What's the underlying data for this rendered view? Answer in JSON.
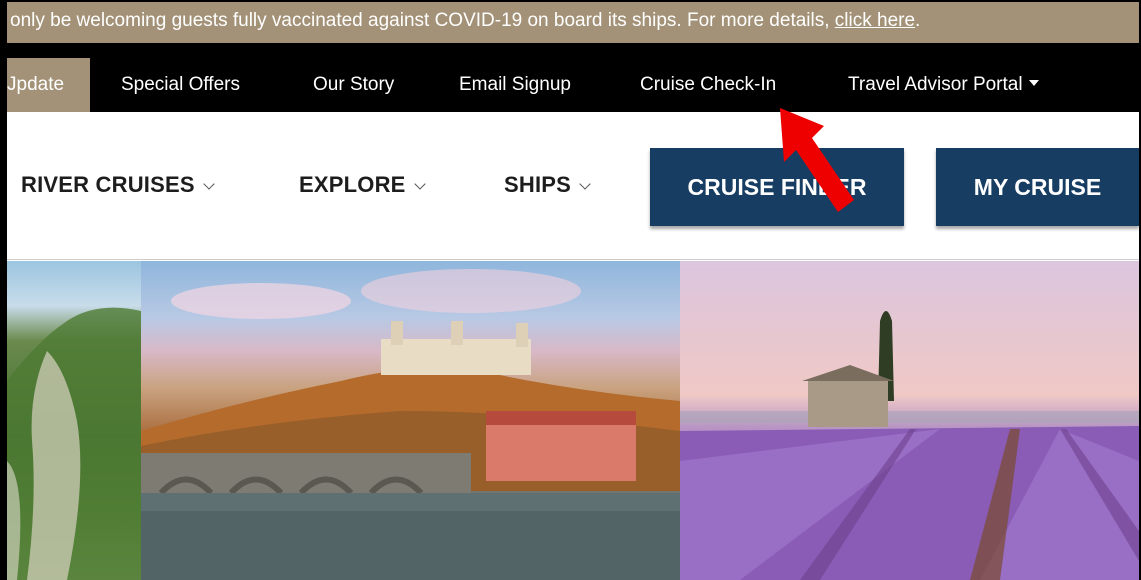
{
  "banner": {
    "text": "only be welcoming guests fully vaccinated against COVID-19 on board its ships. For more details, ",
    "link": "click here",
    "trailing": ".",
    "bg_color": "#a39277"
  },
  "topnav": {
    "items": [
      {
        "label": "Jpdate",
        "active": true
      },
      {
        "label": "Special Offers"
      },
      {
        "label": "Our Story"
      },
      {
        "label": "Email Signup"
      },
      {
        "label": "Cruise Check-In"
      },
      {
        "label": "Travel Advisor Portal",
        "dropdown": true
      }
    ],
    "bg_color": "#000000"
  },
  "mainnav": {
    "items": [
      {
        "label": "RIVER CRUISES"
      },
      {
        "label": "EXPLORE"
      },
      {
        "label": "SHIPS"
      }
    ],
    "buttons": {
      "cruise_finder": "CRUISE FINDER",
      "my_cruise": "MY CRUISE"
    },
    "button_color": "#183d63"
  },
  "hero": {
    "panels": [
      "green-cliffs-image",
      "river-castle-town-image",
      "lavender-field-image"
    ]
  },
  "annotation": {
    "arrow_color": "#ee0000",
    "target": "Cruise Check-In"
  }
}
